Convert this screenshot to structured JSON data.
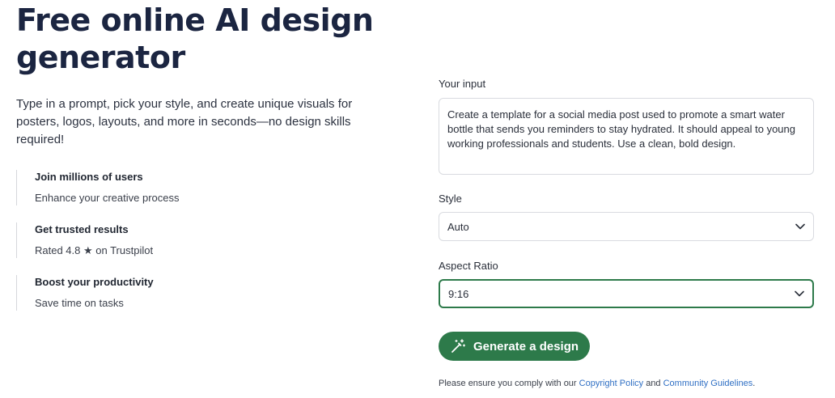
{
  "hero": {
    "title_line1": "Free online AI design",
    "title_line2": "generator",
    "subtitle": "Type in a prompt, pick your style, and create unique visuals for posters, logos, layouts, and more in seconds—no design skills required!"
  },
  "features": [
    {
      "title": "Join millions of users",
      "text": "Enhance your creative process"
    },
    {
      "title": "Get trusted results",
      "text": "Rated 4.8 ★ on Trustpilot"
    },
    {
      "title": "Boost your productivity",
      "text": "Save time on tasks"
    }
  ],
  "form": {
    "input_label": "Your input",
    "input_value": "Create a template for a social media post used to promote a smart water bottle that sends you reminders to stay hydrated. It should appeal to young working professionals and students. Use a clean, bold design.",
    "style_label": "Style",
    "style_value": "Auto",
    "aspect_label": "Aspect Ratio",
    "aspect_value": "9:16",
    "generate_label": "Generate a design"
  },
  "legal": {
    "prefix": "Please ensure you comply with our ",
    "copyright_link": "Copyright Policy",
    "middle": " and ",
    "community_link": "Community Guidelines",
    "suffix": "."
  },
  "colors": {
    "accent": "#2d7a4a",
    "heading": "#1b2541",
    "link": "#2f6fc4"
  },
  "icons": {
    "chevron": "chevron-down-icon",
    "wand": "magic-wand-icon"
  }
}
